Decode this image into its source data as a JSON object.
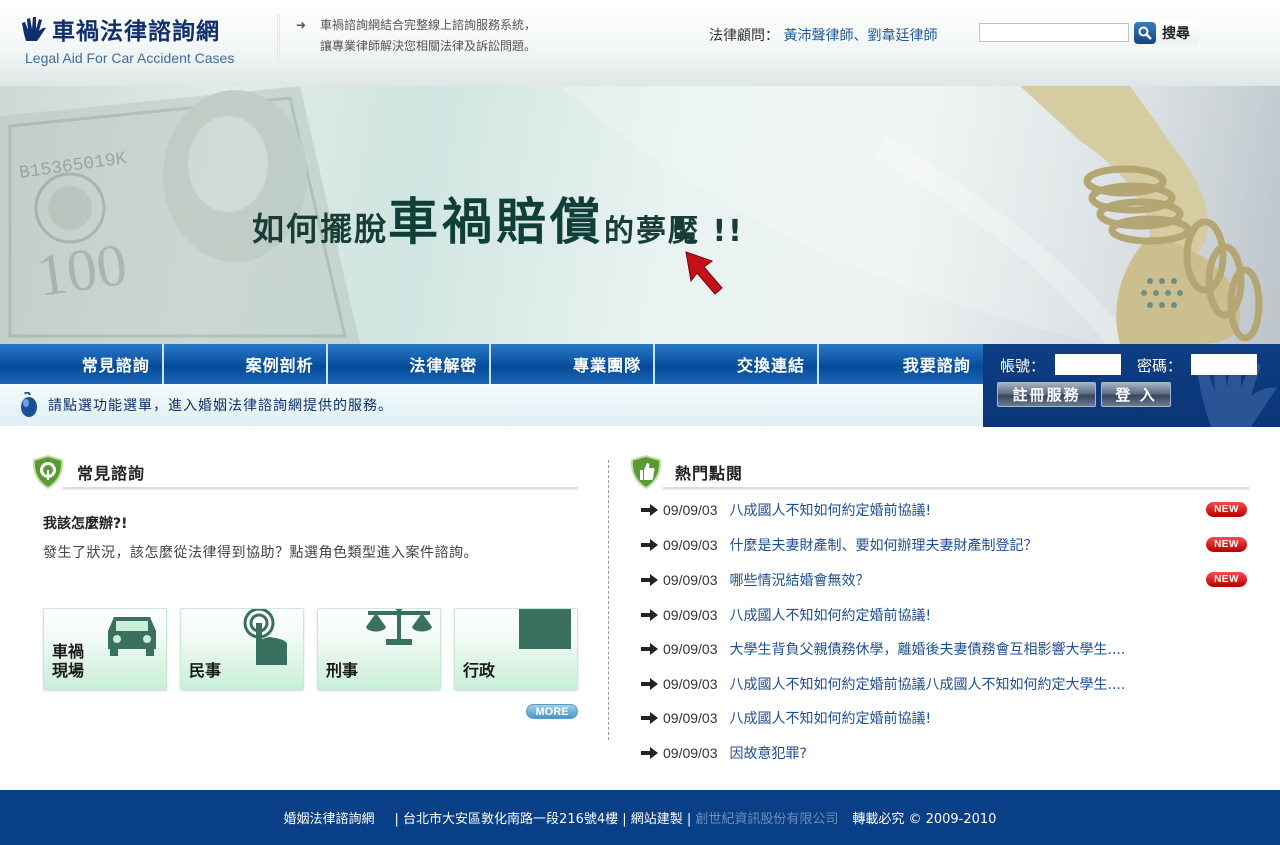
{
  "header": {
    "logo_title": "車禍法律諮詢網",
    "logo_subtitle": "Legal Aid For Car Accident Cases",
    "tagline_line1": "車禍諮詢網結合完整線上諮詢服務系統，",
    "tagline_line2": "讓專業律師解決您相關法律及訴訟問題。",
    "advisors_label": "法律顧問：",
    "advisors_names": "黃沛聲律師、劉韋廷律師",
    "search_placeholder": "",
    "search_label": "搜尋"
  },
  "banner": {
    "slogan_prefix": "如何擺脫",
    "slogan_emphasis": "車禍賠償",
    "slogan_suffix": "的夢魘 !!"
  },
  "nav": {
    "items": [
      "常見諮詢",
      "案例剖析",
      "法律解密",
      "專業團隊",
      "交換連結",
      "我要諮詢"
    ],
    "hint": "請點選功能選單，進入婚姻法律諮詢網提供的服務。"
  },
  "login": {
    "account_label": "帳號：",
    "password_label": "密碼：",
    "register_label": "註冊服務",
    "login_label": "登 入"
  },
  "faq": {
    "title": "常見諮詢",
    "question": "我該怎麼辦?!",
    "description": "發生了狀況，該怎麼從法律得到協助？點選角色類型進入案件諮詢。",
    "categories": [
      "車禍\n現場",
      "民事",
      "刑事",
      "行政"
    ],
    "more_label": "MORE"
  },
  "hot": {
    "title": "熱門點閱",
    "new_label": "NEW",
    "items": [
      {
        "date": "09/09/03",
        "title": "八成國人不知如何約定婚前協議!",
        "new": true
      },
      {
        "date": "09/09/03",
        "title": "什麼是夫妻財產制、要如何辦理夫妻財產制登記？",
        "new": true
      },
      {
        "date": "09/09/03",
        "title": "哪些情況結婚會無效？",
        "new": true
      },
      {
        "date": "09/09/03",
        "title": "八成國人不知如何約定婚前協議!",
        "new": false
      },
      {
        "date": "09/09/03",
        "title": "大學生背負父親債務休學，離婚後夫妻債務會互相影響大學生....",
        "new": false
      },
      {
        "date": "09/09/03",
        "title": "八成國人不知如何約定婚前協議八成國人不知如何約定大學生....",
        "new": false
      },
      {
        "date": "09/09/03",
        "title": "八成國人不知如何約定婚前協議!",
        "new": false
      },
      {
        "date": "09/09/03",
        "title": "因故意犯罪?",
        "new": false
      }
    ]
  },
  "footer": {
    "site_name": "婚姻法律諮詢網",
    "address": "| 台北市大安區敦化南路一段216號4樓 | 網站建製 |",
    "builder": "創世紀資訊股份有限公司",
    "copyright": "轉載必究 © 2009-2010"
  },
  "colors": {
    "nav_blue": "#0d56a6",
    "footer_blue": "#093f86",
    "link_blue": "#1f4f93",
    "badge_red": "#d10000"
  }
}
